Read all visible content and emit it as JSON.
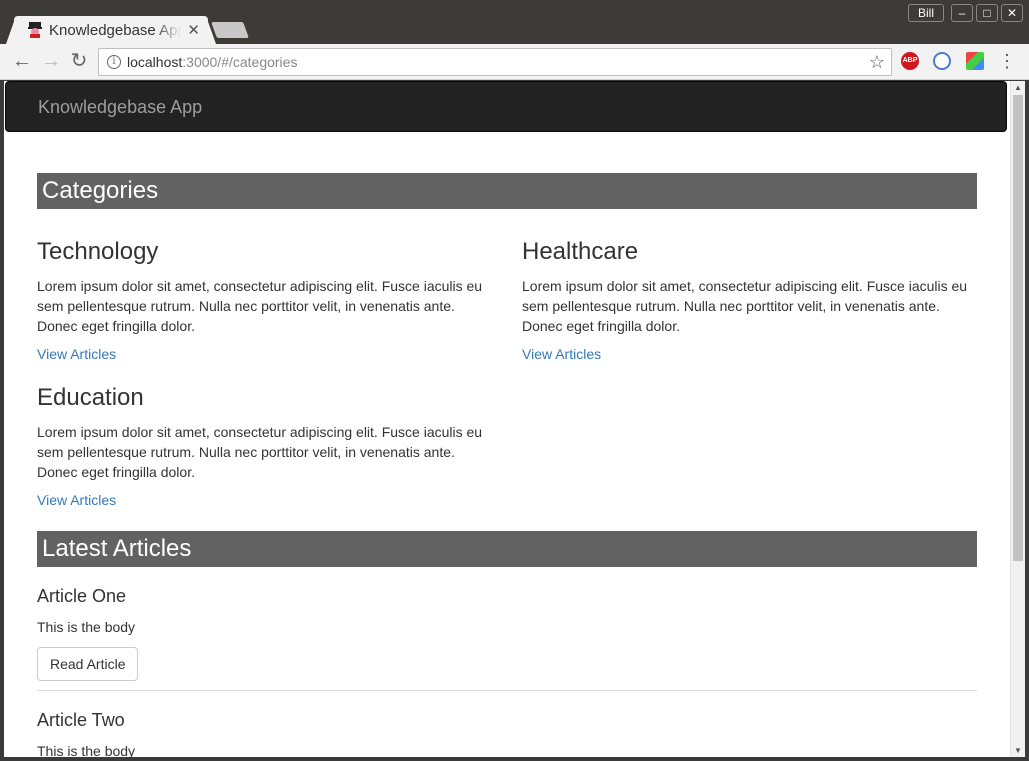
{
  "browser": {
    "tab_title": "Knowledgebase App",
    "tab_close": "✕",
    "user_label": "Bill",
    "url_host": "localhost",
    "url_rest": ":3000/#/categories",
    "back_icon": "←",
    "forward_icon": "→",
    "reload_icon": "↻",
    "star_icon": "☆",
    "abp_label": "ABP",
    "menu_icon": "⋮",
    "minimize_icon": "–",
    "maximize_icon": "□",
    "close_icon": "✕"
  },
  "navbar": {
    "brand": "Knowledgebase App"
  },
  "categories_section": {
    "heading": "Categories",
    "items": [
      {
        "title": "Technology",
        "description": "Lorem ipsum dolor sit amet, consectetur adipiscing elit. Fusce iaculis eu sem pellentesque rutrum. Nulla nec porttitor velit, in venenatis ante. Donec eget fringilla dolor.",
        "link": "View Articles"
      },
      {
        "title": "Healthcare",
        "description": "Lorem ipsum dolor sit amet, consectetur adipiscing elit. Fusce iaculis eu sem pellentesque rutrum. Nulla nec porttitor velit, in venenatis ante. Donec eget fringilla dolor.",
        "link": "View Articles"
      },
      {
        "title": "Education",
        "description": "Lorem ipsum dolor sit amet, consectetur adipiscing elit. Fusce iaculis eu sem pellentesque rutrum. Nulla nec porttitor velit, in venenatis ante. Donec eget fringilla dolor.",
        "link": "View Articles"
      }
    ]
  },
  "articles_section": {
    "heading": "Latest Articles",
    "items": [
      {
        "title": "Article One",
        "body": "This is the body",
        "button": "Read Article"
      },
      {
        "title": "Article Two",
        "body": "This is the body"
      }
    ]
  },
  "colors": {
    "navbar_bg": "#222222",
    "section_head_bg": "#626262",
    "link": "#337ab7"
  }
}
